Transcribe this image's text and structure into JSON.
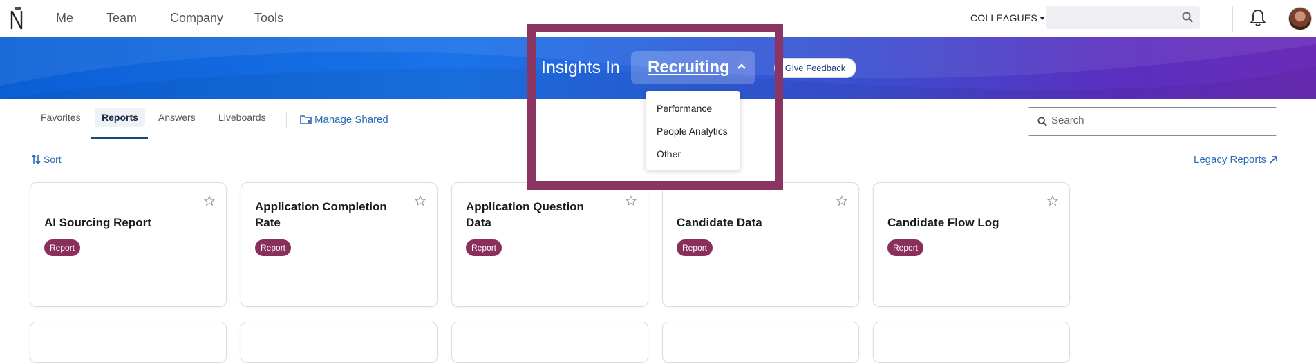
{
  "topnav": {
    "items": [
      "Me",
      "Team",
      "Company",
      "Tools"
    ],
    "colleagues_label": "COLLEAGUES",
    "search_placeholder": ""
  },
  "banner": {
    "insights_label": "Insights In",
    "department": "Recruiting",
    "feedback_label": "Give Feedback"
  },
  "dropdown": {
    "options": [
      "Performance",
      "People Analytics",
      "Other"
    ]
  },
  "tabs": {
    "items": [
      "Favorites",
      "Reports",
      "Answers",
      "Liveboards"
    ],
    "active": "Reports",
    "manage_shared": "Manage Shared",
    "search_placeholder": "Search"
  },
  "toolbar": {
    "sort_label": "Sort",
    "legacy_label": "Legacy Reports"
  },
  "cards": [
    {
      "title": "AI Sourcing Report",
      "badge": "Report"
    },
    {
      "title": "Application Completion Rate",
      "badge": "Report"
    },
    {
      "title": "Application Question Data",
      "badge": "Report"
    },
    {
      "title": "Candidate Data",
      "badge": "Report"
    },
    {
      "title": "Candidate Flow Log",
      "badge": "Report"
    }
  ],
  "colors": {
    "accent": "#2a6bb8",
    "badge": "#8a2f5c",
    "highlight": "#8b3563",
    "banner_start": "#0b5fd6",
    "banner_end": "#6a2cb8"
  }
}
